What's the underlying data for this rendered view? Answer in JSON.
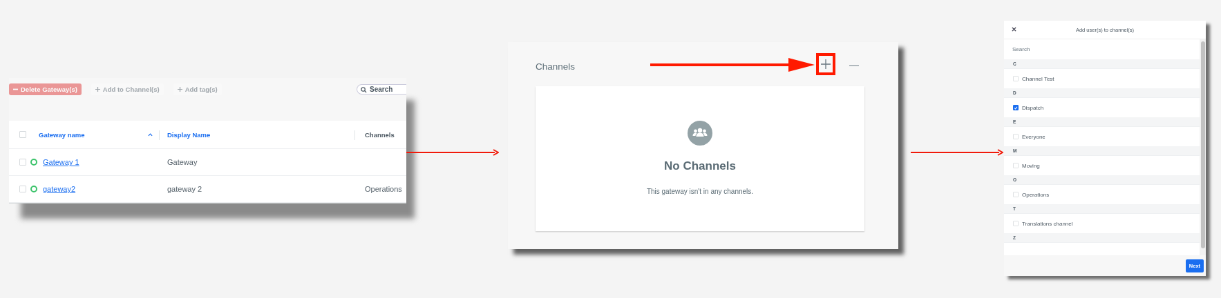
{
  "gateways_panel": {
    "toolbar": [
      {
        "kind": "remove",
        "label": "Delete Gateway(s)",
        "disabled": true
      },
      {
        "kind": "add",
        "label": "Add to Channel(s)",
        "disabled": true
      },
      {
        "kind": "add",
        "label": "Add tag(s)",
        "disabled": true
      }
    ],
    "search": {
      "placeholder": "Search"
    },
    "columns": [
      {
        "label": "Gateway name",
        "sorted": true,
        "link": true
      },
      {
        "label": "Display Name",
        "sorted": false,
        "link": true
      },
      {
        "label": "Channels",
        "sorted": false,
        "link": false
      }
    ],
    "select_all": {
      "checked": false
    },
    "rows": [
      {
        "checked": false,
        "color": "#3cc36b",
        "name": "Gateway 1",
        "display_name": "Gateway",
        "channels": ""
      },
      {
        "checked": false,
        "color": "#3cc36b",
        "name": "gateway2",
        "display_name": "gateway 2",
        "channels": "Operations"
      }
    ]
  },
  "channels_panel": {
    "title": "Channels",
    "add_highlighted": true,
    "empty_title": "No Channels",
    "empty_text": "This gateway isn't in any channels."
  },
  "add_dialog": {
    "title": "Add user(s) to channel(s)",
    "search": {
      "placeholder": "Search"
    },
    "sections": [
      {
        "letter": "C",
        "items": [
          {
            "label": "Channel Test",
            "checked": false
          }
        ]
      },
      {
        "letter": "D",
        "items": [
          {
            "label": "Dispatch",
            "checked": true
          }
        ]
      },
      {
        "letter": "E",
        "items": [
          {
            "label": "Everyone",
            "checked": false
          }
        ]
      },
      {
        "letter": "M",
        "items": [
          {
            "label": "Moving",
            "checked": false
          }
        ]
      },
      {
        "letter": "O",
        "items": [
          {
            "label": "Operations",
            "checked": false
          }
        ]
      },
      {
        "letter": "T",
        "items": [
          {
            "label": "Translations channel",
            "checked": false
          }
        ]
      },
      {
        "letter": "Z"
      }
    ],
    "next_button": "Next"
  }
}
